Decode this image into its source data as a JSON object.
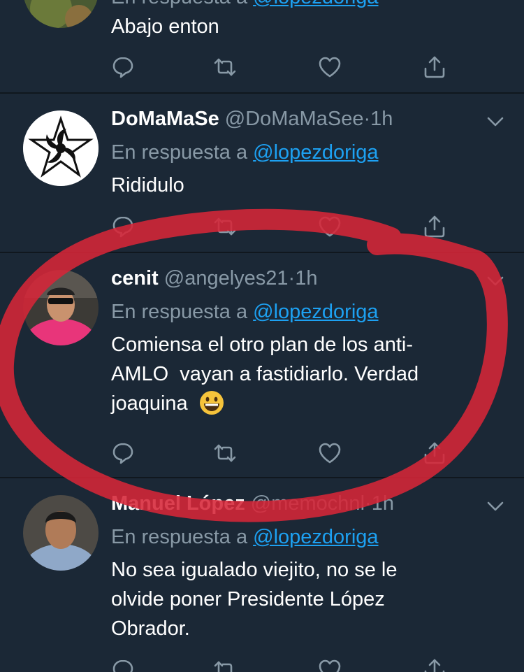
{
  "tweets": [
    {
      "reply_prefix": "En respuesta a",
      "reply_to": "@lopezdoriga",
      "body": "Abajo enton"
    },
    {
      "display_name": "DoMaMaSe",
      "handle": "@DoMaMaSee",
      "separator": "·",
      "time": "1h",
      "reply_prefix": "En respuesta a",
      "reply_to": "@lopezdoriga",
      "body": "Rididulo"
    },
    {
      "display_name": "cenit",
      "handle": "@angelyes21",
      "separator": "·",
      "time": "1h",
      "reply_prefix": "En respuesta a",
      "reply_to": "@lopezdoriga",
      "body_line1": "Comiensa el otro plan de los anti-",
      "body_line2": "AMLO  vayan a fastidiarlo. Verdad",
      "body_line3": "joaquina",
      "emoji": "grinning-face"
    },
    {
      "display_name": "Manuel López",
      "handle": "@memochnl",
      "separator": "·",
      "time": "1h",
      "reply_prefix": "En respuesta a",
      "reply_to": "@lopezdoriga",
      "body_line1": "No sea igualado viejito, no se le",
      "body_line2": "olvide poner Presidente López",
      "body_line3": "Obrador."
    }
  ],
  "icons": {
    "reply": "reply-icon",
    "retweet": "retweet-icon",
    "like": "heart-icon",
    "share": "share-icon",
    "more": "chevron-down-icon"
  },
  "colors": {
    "background": "#1b2836",
    "divider": "#10171e",
    "secondary_text": "#8899a6",
    "link": "#1da1f2",
    "annotation_circle": "#d62638"
  }
}
